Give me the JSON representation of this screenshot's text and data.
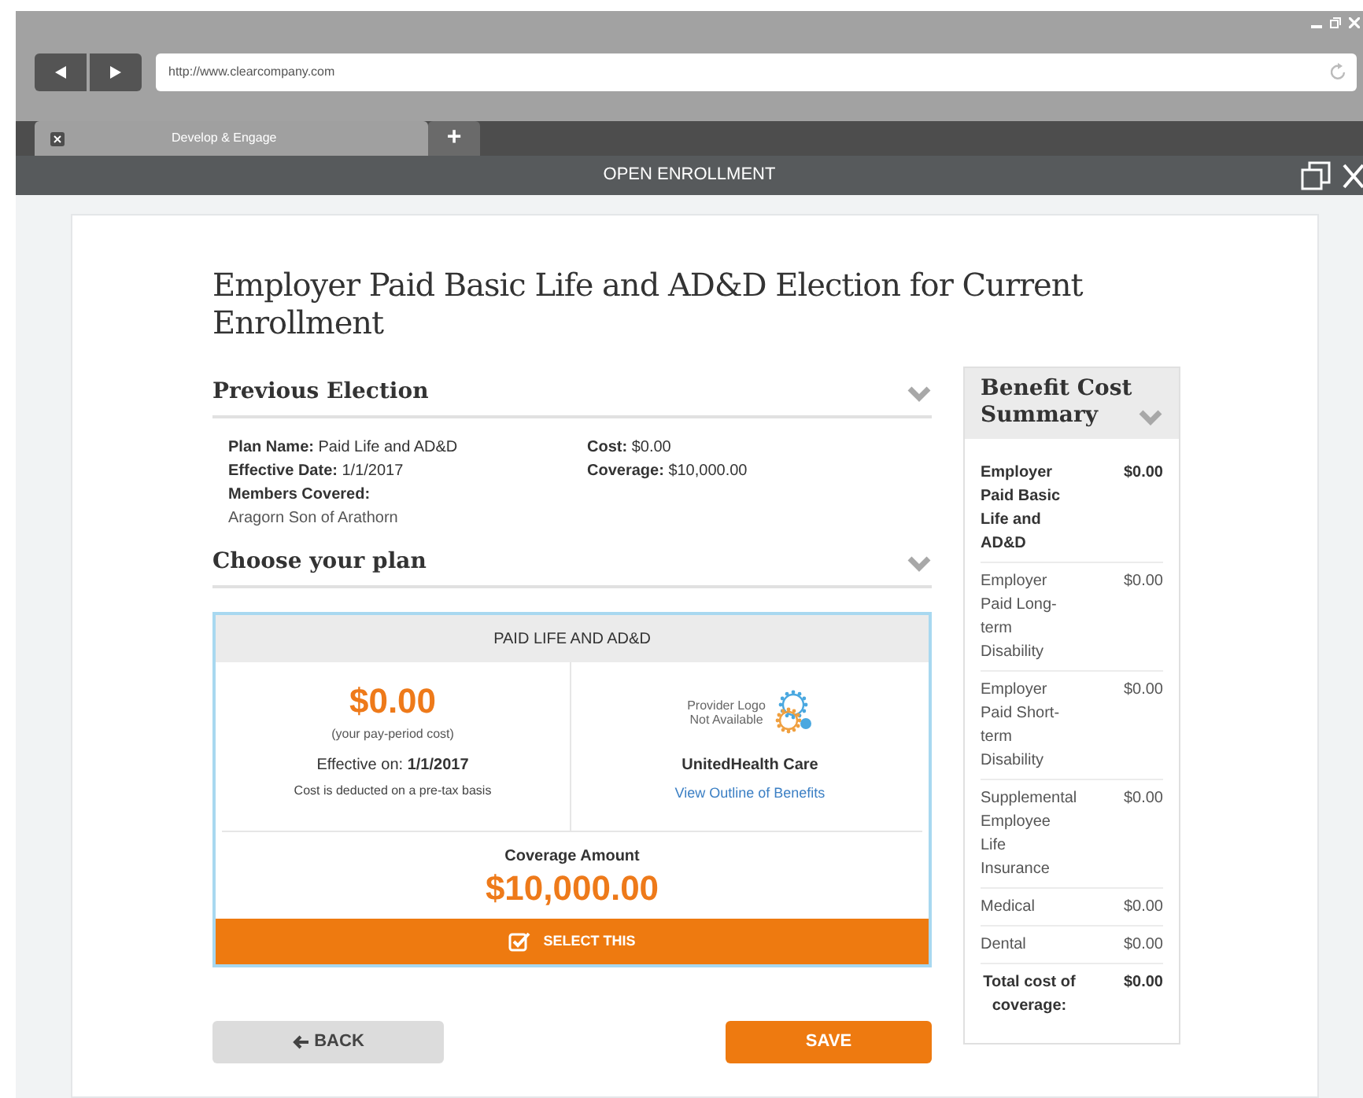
{
  "browser": {
    "url": "http://www.clearcompany.com",
    "tab": "Develop & Engage",
    "new_tab": "+"
  },
  "header": {
    "title": "OPEN ENROLLMENT"
  },
  "page": {
    "title": "Employer Paid Basic Life and AD&D Election for Current Enrollment"
  },
  "previous_election": {
    "heading": "Previous Election",
    "expanded": true,
    "left": [
      {
        "label": "Plan Name:",
        "value": "Paid Life and AD&D"
      },
      {
        "label": "Effective Date:",
        "value": "1/1/2017"
      },
      {
        "label": "Members Covered:"
      }
    ],
    "member": "Aragorn Son of Arathorn",
    "right": [
      {
        "label": "Cost:",
        "value": "$0.00"
      },
      {
        "label": "Coverage:",
        "value": "$10,000.00"
      }
    ]
  },
  "choose_plan": {
    "heading": "Choose your plan",
    "expanded": true
  },
  "plan": {
    "name": "PAID LIFE AND AD&D",
    "selected": true,
    "cost": "$0.00",
    "cost_note": "(your pay-period cost)",
    "effective_label": "Effective on:",
    "effective_date": "1/1/2017",
    "tax_note": "Cost is deducted on a pre-tax basis",
    "logo_text": "Provider Logo Not Available",
    "provider": "UnitedHealth Care",
    "link": "View Outline of Benefits",
    "coverage_label": "Coverage Amount",
    "coverage": "$10,000.00",
    "select_label": "SELECT THIS"
  },
  "buttons": {
    "back": "BACK",
    "save": "SAVE"
  },
  "summary": {
    "title": "Benefit Cost Summary",
    "expanded": true,
    "items": [
      {
        "kind": "item",
        "bold": true,
        "name": "Employer Paid Basic Life and AD&D",
        "cost": "$0.00"
      },
      {
        "kind": "item",
        "bold": false,
        "name": "Employer Paid Long-term Disability",
        "cost": "$0.00"
      },
      {
        "kind": "item",
        "bold": false,
        "name": "Employer Paid Short-term Disability",
        "cost": "$0.00"
      },
      {
        "kind": "item",
        "bold": false,
        "name": "Supplemental Employee Life Insurance",
        "cost": "$0.00"
      },
      {
        "kind": "item",
        "bold": false,
        "name": "Medical",
        "cost": "$0.00"
      },
      {
        "kind": "item",
        "bold": false,
        "name": "Dental",
        "cost": "$0.00"
      },
      {
        "kind": "total",
        "bold": true,
        "name": "Total cost of coverage:",
        "cost": "$0.00"
      }
    ]
  }
}
